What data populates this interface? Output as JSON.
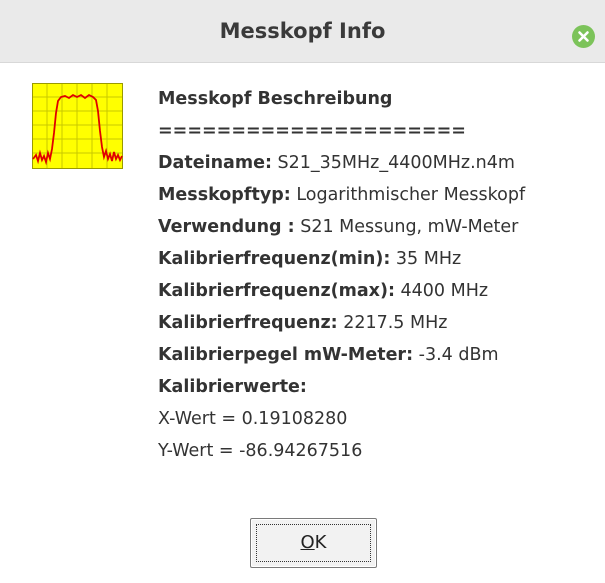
{
  "window": {
    "title": "Messkopf Info",
    "close_icon": "close-icon"
  },
  "info": {
    "heading": "Messkopf Beschreibung",
    "separator": "=====================",
    "rows": [
      {
        "key": "Dateiname:",
        "value": " S21_35MHz_4400MHz.n4m"
      },
      {
        "key": "Messkopftyp:",
        "value": " Logarithmischer Messkopf"
      },
      {
        "key": "Verwendung :",
        "value": " S21 Messung, mW-Meter"
      },
      {
        "key": "Kalibrierfrequenz(min):",
        "value": " 35 MHz"
      },
      {
        "key": "Kalibrierfrequenz(max):",
        "value": " 4400 MHz"
      },
      {
        "key": "Kalibrierfrequenz:",
        "value": " 2217.5 MHz"
      },
      {
        "key": "Kalibrierpegel mW-Meter:",
        "value": " -3.4 dBm"
      }
    ],
    "calib_heading": "Kalibrierwerte:",
    "x_value": "X-Wert = 0.19108280",
    "y_value": "Y-Wert = -86.94267516"
  },
  "button": {
    "ok_mnemonic": "O",
    "ok_rest": "K"
  },
  "colors": {
    "titlebar": "#eaeaea",
    "close": "#7cc35a",
    "icon_background": "#ffff00",
    "icon_trace": "#e00000"
  }
}
